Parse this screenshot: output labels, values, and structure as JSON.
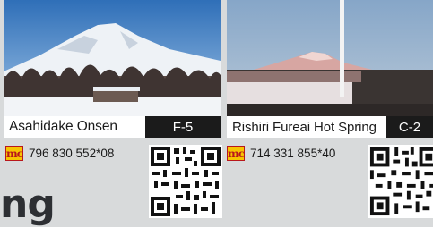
{
  "spots": [
    {
      "name": "Asahidake Onsen",
      "grid": "F-5",
      "mapcode": "796 830 552*08",
      "mapcode_logo": "mc"
    },
    {
      "name": "Rishiri Fureai Hot Spring",
      "grid": "C-2",
      "mapcode": "714 331 855*40",
      "mapcode_logo": "mc"
    }
  ],
  "heading": "ng",
  "colors": {
    "background": "#d8dadb",
    "mapcode_logo_fill": "#f7c400",
    "mapcode_logo_border": "#b8171c",
    "grid_badge": "#1b1b1b"
  }
}
